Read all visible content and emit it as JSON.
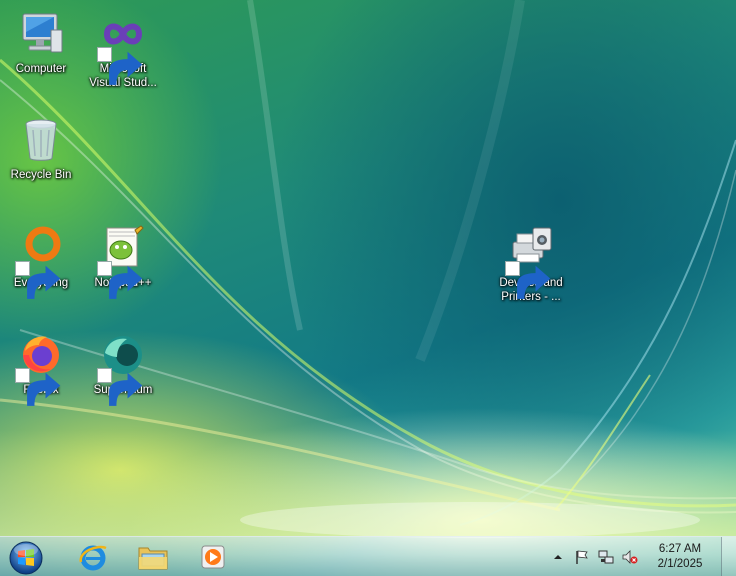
{
  "desktop": {
    "icons": [
      {
        "label": "Computer",
        "icon": "computer-icon",
        "shortcut": false
      },
      {
        "label": "Microsoft\nVisual Stud...",
        "icon": "visual-studio-icon",
        "shortcut": true
      },
      {
        "label": "Recycle Bin",
        "icon": "recycle-bin-icon",
        "shortcut": false
      },
      {
        "label": "Everything",
        "icon": "everything-icon",
        "shortcut": true
      },
      {
        "label": "Notepad++",
        "icon": "notepad-plus-plus-icon",
        "shortcut": true
      },
      {
        "label": "Devices and\nPrinters - ...",
        "icon": "devices-printers-icon",
        "shortcut": true
      },
      {
        "label": "Firefox",
        "icon": "firefox-icon",
        "shortcut": true
      },
      {
        "label": "Supermium",
        "icon": "supermium-icon",
        "shortcut": true
      }
    ]
  },
  "taskbar": {
    "start_icon": "windows-orb-icon",
    "pinned": [
      {
        "name": "Internet Explorer",
        "icon": "internet-explorer-icon"
      },
      {
        "name": "Windows Explorer",
        "icon": "folder-icon"
      },
      {
        "name": "Windows Media Player",
        "icon": "media-player-icon"
      }
    ],
    "tray": {
      "icons": [
        "show-hidden-icons-arrow",
        "action-center-flag-icon",
        "network-icon",
        "volume-muted-icon"
      ],
      "time": "6:27 AM",
      "date": "2/1/2025"
    }
  },
  "colors": {
    "wallpaper_teal": "#137a86",
    "wallpaper_green": "#2e9a55",
    "wallpaper_yellow": "#e6f05a",
    "label_text": "#ffffff"
  }
}
